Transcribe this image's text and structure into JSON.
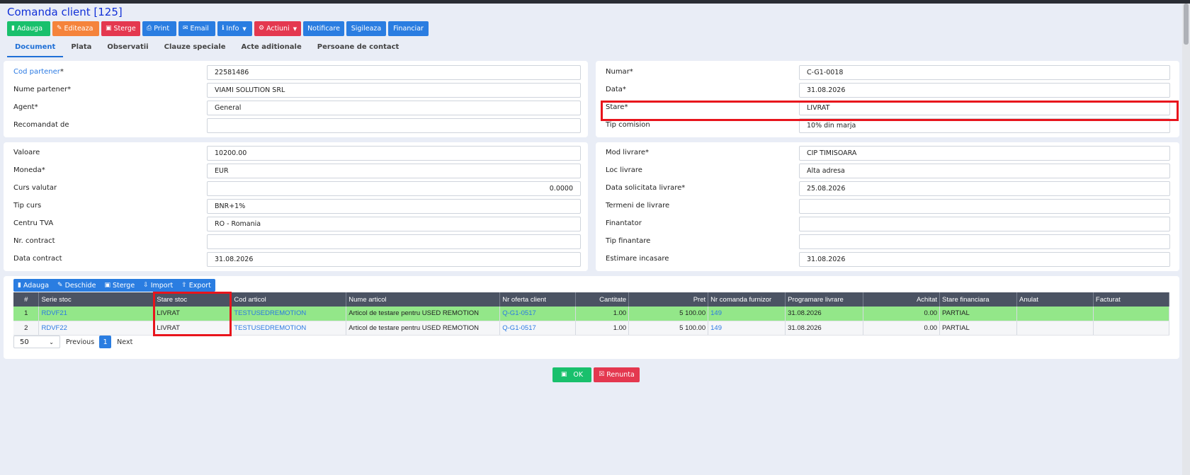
{
  "title": "Comanda client [125]",
  "toolbar": {
    "adauga": "Adauga",
    "editeaza": "Editeaza",
    "sterge": "Sterge",
    "print": "Print",
    "email": "Email",
    "info": "Info",
    "actiuni": "Actiuni",
    "notificare": "Notificare",
    "sigileaza": "Sigileaza",
    "financiar": "Financiar"
  },
  "tabs": [
    "Document",
    "Plata",
    "Observatii",
    "Clauze speciale",
    "Acte aditionale",
    "Persoane de contact"
  ],
  "partner": {
    "cod_partener_label": "Cod partener",
    "cod_partener": "22581486",
    "nume_partener_label": "Nume partener*",
    "nume_partener": "VIAMI SOLUTION SRL",
    "agent_label": "Agent*",
    "agent": "General",
    "recomandat_label": "Recomandat de",
    "recomandat": ""
  },
  "doc": {
    "numar_label": "Numar*",
    "numar": "C-G1-0018",
    "data_label": "Data*",
    "data": "31.08.2026",
    "stare_label": "Stare*",
    "stare": "LIVRAT",
    "tip_comision_label": "Tip comision",
    "tip_comision": "10% din marja"
  },
  "finance": {
    "valoare_label": "Valoare",
    "valoare": "10200.00",
    "moneda_label": "Moneda*",
    "moneda": "EUR",
    "curs_label": "Curs valutar",
    "curs": "0.0000",
    "tip_curs_label": "Tip curs",
    "tip_curs": "BNR+1%",
    "centru_tva_label": "Centru TVA",
    "centru_tva": "RO - Romania",
    "nr_contract_label": "Nr. contract",
    "nr_contract": "",
    "data_contract_label": "Data contract",
    "data_contract": "31.08.2026"
  },
  "delivery": {
    "mod_livrare_label": "Mod livrare*",
    "mod_livrare": "CIP TIMISOARA",
    "loc_livrare_label": "Loc livrare",
    "loc_livrare": "Alta adresa",
    "data_solicitata_label": "Data solicitata livrare*",
    "data_solicitata": "25.08.2026",
    "termeni_label": "Termeni de livrare",
    "termeni": "",
    "finantator_label": "Finantator",
    "finantator": "",
    "tip_finantare_label": "Tip finantare",
    "tip_finantare": "",
    "estimare_label": "Estimare incasare",
    "estimare": "31.08.2026"
  },
  "grid_toolbar": {
    "adauga": "Adauga",
    "deschide": "Deschide",
    "sterge": "Sterge",
    "import": "Import",
    "export": "Export"
  },
  "grid": {
    "columns": [
      "#",
      "Serie stoc",
      "Stare stoc",
      "Cod articol",
      "Nume articol",
      "Nr oferta client",
      "Cantitate",
      "Pret",
      "Nr comanda furnizor",
      "Programare livrare",
      "Achitat",
      "Stare financiara",
      "Anulat",
      "Facturat"
    ],
    "rows": [
      [
        "1",
        "RDVF21",
        "LIVRAT",
        "TESTUSEDREMOTION",
        "Articol de testare pentru USED REMOTION",
        "Q-G1-0517",
        "1.00",
        "5 100.00",
        "149",
        "31.08.2026",
        "0.00",
        "PARTIAL",
        "",
        ""
      ],
      [
        "2",
        "RDVF22",
        "LIVRAT",
        "TESTUSEDREMOTION",
        "Articol de testare pentru USED REMOTION",
        "Q-G1-0517",
        "1.00",
        "5 100.00",
        "149",
        "31.08.2026",
        "0.00",
        "PARTIAL",
        "",
        ""
      ]
    ]
  },
  "pager": {
    "page_size": "50",
    "previous": "Previous",
    "current": "1",
    "next": "Next"
  },
  "footer": {
    "ok": "OK",
    "renunta": "Renunta"
  }
}
